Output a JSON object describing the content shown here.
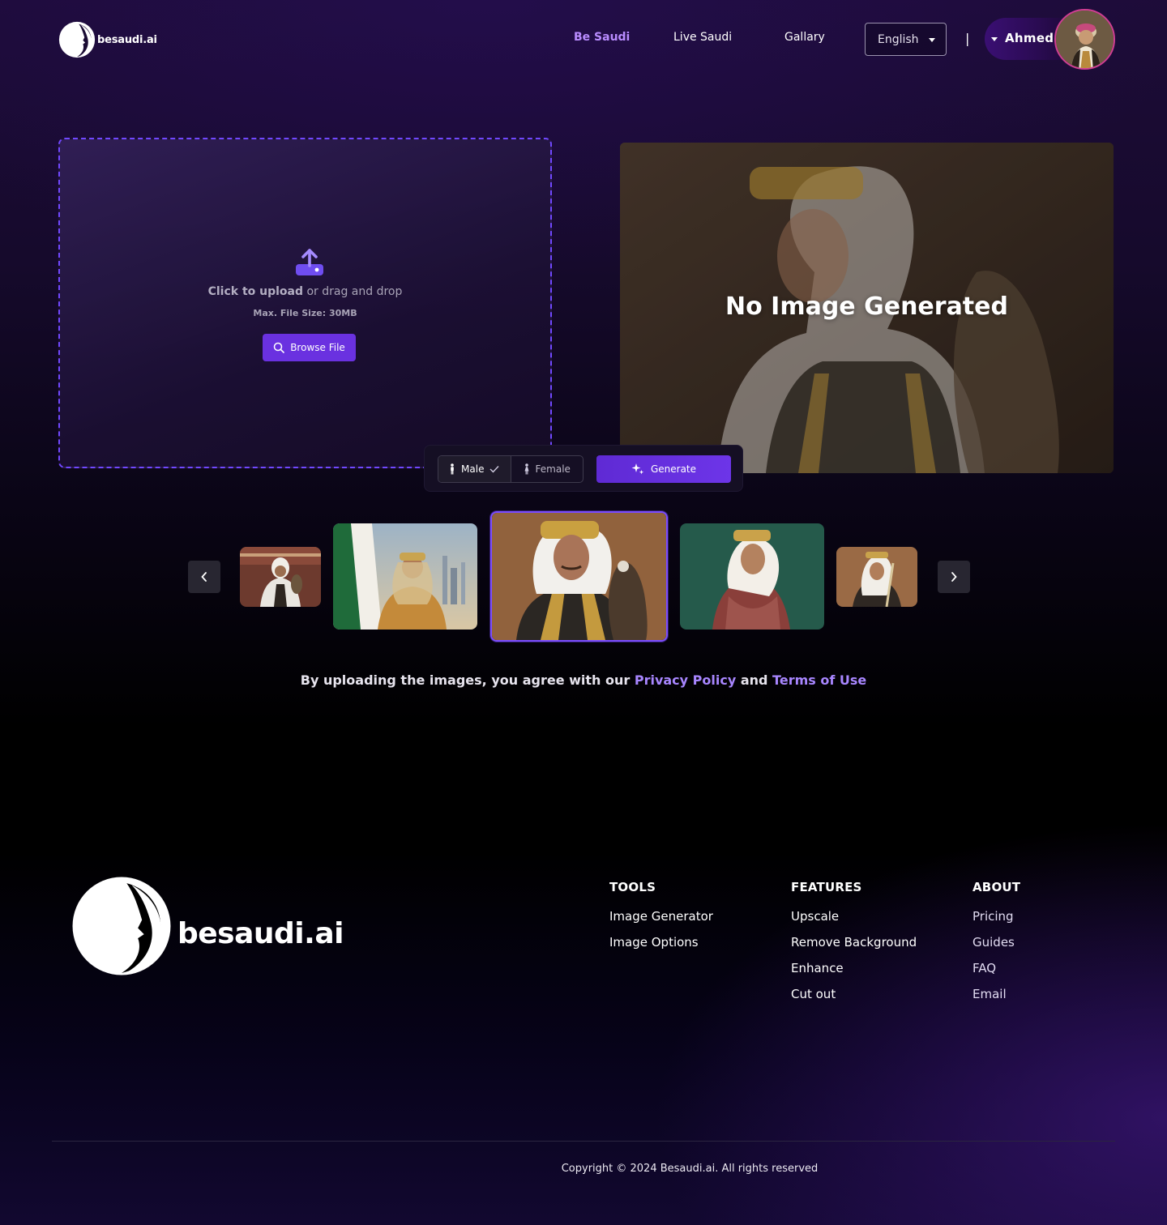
{
  "brand": {
    "name": "besaudi.ai"
  },
  "nav": {
    "items": [
      "Be Saudi",
      "Live Saudi",
      "Gallary"
    ],
    "active": "Be Saudi",
    "active_color": "#b98cff"
  },
  "language": {
    "selected": "English"
  },
  "user": {
    "name": "Ahmed",
    "avatar_ring": "#d03e93"
  },
  "upload": {
    "click_text": "Click to upload",
    "drag_text": " or drag and drop",
    "max_size": "Max. File Size: 30MB",
    "browse_label": "Browse File",
    "accent": "#7148ff"
  },
  "preview": {
    "status": "No Image Generated"
  },
  "options": {
    "gender": [
      "Male",
      "Female"
    ],
    "selected_gender": "Male",
    "generate_label": "Generate",
    "button_color": "#6a31e0"
  },
  "carousel": {
    "items": [
      "falconer-market",
      "saluting-flag",
      "falcon-portrait",
      "red-shemagh",
      "sword-portrait"
    ],
    "active_index": 2
  },
  "consent": {
    "prefix": "By uploading the images, you agree with our ",
    "privacy": "Privacy Policy",
    "middle": " and ",
    "terms": "Terms of Use"
  },
  "footer": {
    "columns": [
      {
        "title": "TOOLS",
        "links": [
          "Image Generator",
          "Image Options"
        ]
      },
      {
        "title": "FEATURES",
        "links": [
          "Upscale",
          "Remove Background",
          "Enhance",
          "Cut out"
        ]
      },
      {
        "title": "ABOUT",
        "links": [
          "Pricing",
          "Guides",
          "FAQ",
          "Email"
        ]
      }
    ],
    "copyright": "Copyright © 2024 Besaudi.ai. All rights reserved"
  },
  "icons": [
    "logo-face-icon",
    "chevron-down-icon",
    "upload-icon",
    "search-icon",
    "male-icon",
    "female-icon",
    "check-icon",
    "sparkle-icon",
    "chevron-left-icon",
    "chevron-right-icon"
  ]
}
